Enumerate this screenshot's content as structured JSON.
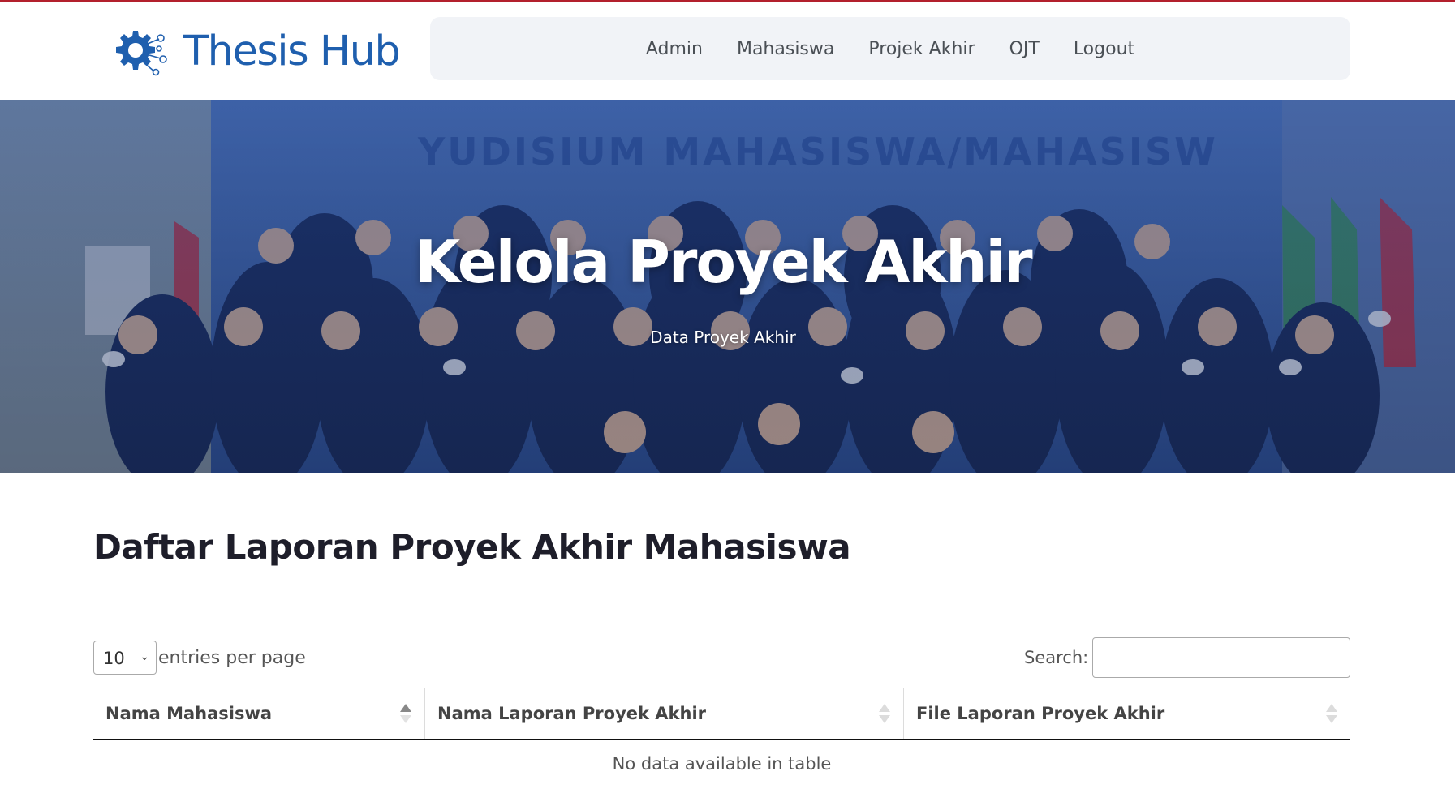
{
  "brand": {
    "name": "Thesis Hub",
    "logo_icon": "gear-network-icon"
  },
  "nav": {
    "items": [
      {
        "label": "Admin"
      },
      {
        "label": "Mahasiswa"
      },
      {
        "label": "Projek Akhir"
      },
      {
        "label": "OJT"
      },
      {
        "label": "Logout"
      }
    ]
  },
  "hero": {
    "title": "Kelola Proyek Akhir",
    "subtitle": "Data Proyek Akhir",
    "background_banner_text": "YUDISIUM MAHASISWA/MAHASISW",
    "image_description_icon": "graduation-group-photo"
  },
  "content": {
    "heading": "Daftar Laporan Proyek Akhir Mahasiswa"
  },
  "table_controls": {
    "entries_value": "10",
    "entries_label": "entries per page",
    "search_label": "Search:",
    "search_value": ""
  },
  "table": {
    "columns": [
      "Nama Mahasiswa",
      "Nama Laporan Proyek Akhir",
      "File Laporan Proyek Akhir"
    ],
    "empty_message": "No data available in table"
  },
  "colors": {
    "brand_blue": "#1f5fae",
    "top_line": "#b3202d",
    "nav_bg": "#f1f3f7"
  }
}
